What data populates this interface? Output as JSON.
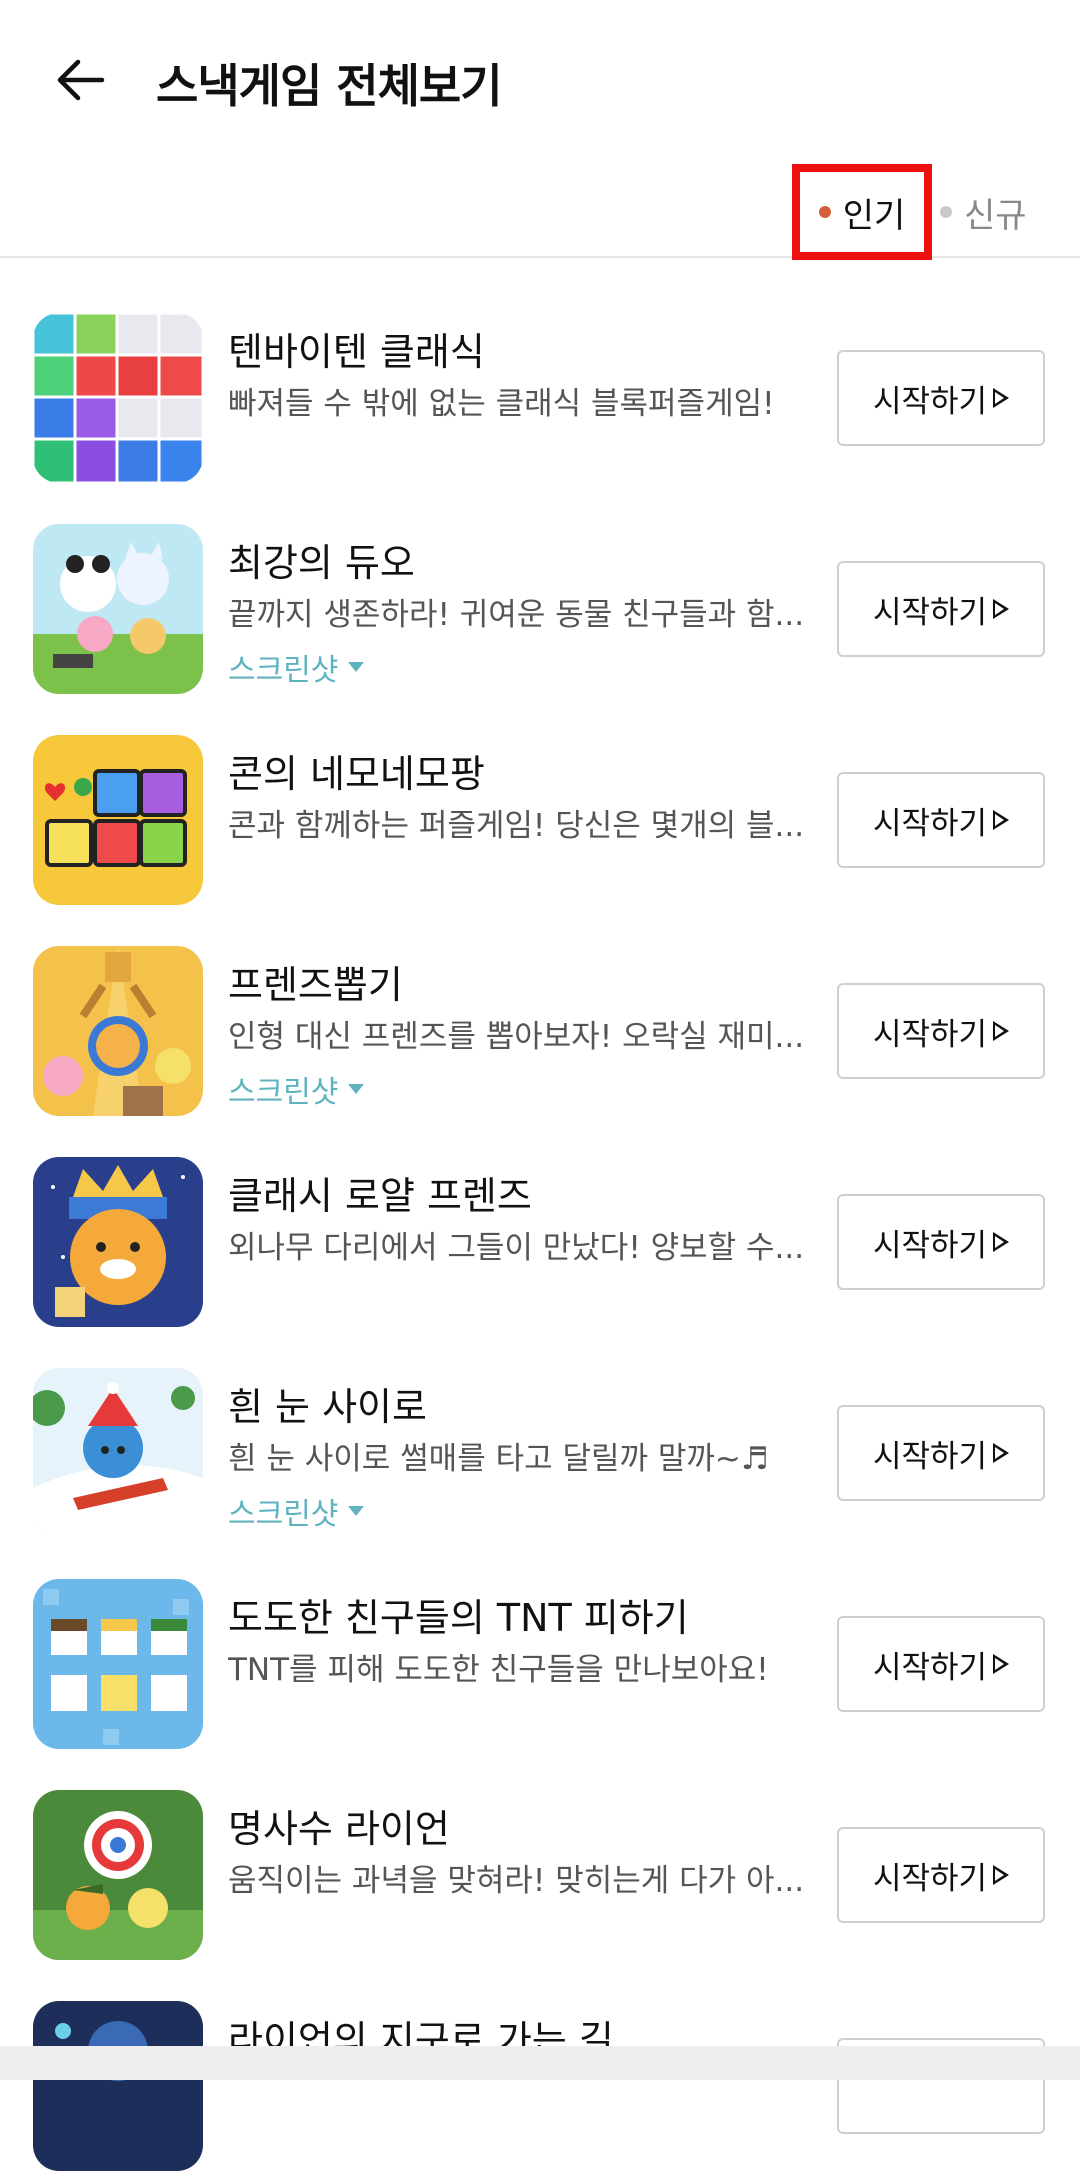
{
  "header": {
    "title": "스낵게임 전체보기",
    "back_icon": "arrow-left-icon"
  },
  "sort": {
    "popular": {
      "label": "인기",
      "dot_color": "#d4603a",
      "selected": true
    },
    "new": {
      "label": "신규",
      "dot_color": "#c8c8c8",
      "selected": false
    },
    "highlight_color": "#ee1111"
  },
  "games": [
    {
      "name": "텐바이텐 클래식",
      "desc": "빠져들 수 밖에 없는 클래식 블록퍼즐게임!",
      "screenshot": null,
      "start": "시작하기"
    },
    {
      "name": "최강의 듀오",
      "desc": "끝까지 생존하라! 귀여운 동물 친구들과 함...",
      "screenshot": "스크린샷",
      "start": "시작하기"
    },
    {
      "name": "콘의 네모네모팡",
      "desc": "콘과 함께하는 퍼즐게임! 당신은 몇개의 블...",
      "screenshot": null,
      "start": "시작하기"
    },
    {
      "name": "프렌즈뽑기",
      "desc": "인형 대신 프렌즈를 뽑아보자! 오락실 재미...",
      "screenshot": "스크린샷",
      "start": "시작하기"
    },
    {
      "name": "클래시 로얄 프렌즈",
      "desc": "외나무 다리에서 그들이 만났다! 양보할 수...",
      "screenshot": null,
      "start": "시작하기"
    },
    {
      "name": "흰 눈 사이로",
      "desc": "흰 눈 사이로 썰매를 타고 달릴까 말까~♬",
      "screenshot": "스크린샷",
      "start": "시작하기"
    },
    {
      "name": "도도한 친구들의 TNT 피하기",
      "desc": "TNT를 피해 도도한 친구들을 만나보아요!",
      "screenshot": null,
      "start": "시작하기"
    },
    {
      "name": "명사수 라이언",
      "desc": "움직이는 과녁을 맞혀라! 맞히는게 다가 아...",
      "screenshot": null,
      "start": "시작하기"
    },
    {
      "name": "라이언의 지구로 가는 길",
      "desc": "",
      "screenshot": null,
      "start": ""
    }
  ],
  "colors": {
    "screenshot_link": "#5fb3bf",
    "divider": "#e6e6e6"
  }
}
